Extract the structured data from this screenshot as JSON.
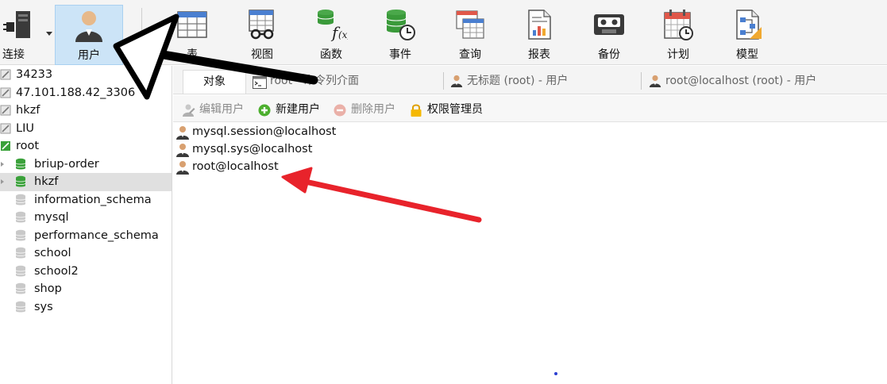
{
  "toolbar": {
    "connect": {
      "label": "连接",
      "icon": "plug-server-icon"
    },
    "user": {
      "label": "用户",
      "icon": "user-icon"
    },
    "table": {
      "label": "表",
      "icon": "table-icon"
    },
    "view": {
      "label": "视图",
      "icon": "view-icon"
    },
    "function": {
      "label": "函数",
      "icon": "function-icon"
    },
    "event": {
      "label": "事件",
      "icon": "event-icon"
    },
    "query": {
      "label": "查询",
      "icon": "query-icon"
    },
    "report": {
      "label": "报表",
      "icon": "report-icon"
    },
    "backup": {
      "label": "备份",
      "icon": "backup-icon"
    },
    "schedule": {
      "label": "计划",
      "icon": "calendar-icon"
    },
    "model": {
      "label": "模型",
      "icon": "model-icon"
    }
  },
  "sidebar": {
    "connections": [
      {
        "label": "34233"
      },
      {
        "label": "47.101.188.42_3306"
      },
      {
        "label": "hkzf"
      },
      {
        "label": "LIU"
      },
      {
        "label": "root"
      }
    ],
    "databases": [
      {
        "label": "briup-order",
        "active": true
      },
      {
        "label": "hkzf",
        "active": true,
        "selected": true
      },
      {
        "label": "information_schema",
        "active": false
      },
      {
        "label": "mysql",
        "active": false
      },
      {
        "label": "performance_schema",
        "active": false
      },
      {
        "label": "school",
        "active": false
      },
      {
        "label": "school2",
        "active": false
      },
      {
        "label": "shop",
        "active": false
      },
      {
        "label": "sys",
        "active": false
      }
    ]
  },
  "tabs": {
    "objects": "对象",
    "console": "root - 命令列介面",
    "untitled": "无标题 (root) - 用户",
    "root_user": "root@localhost (root) - 用户"
  },
  "object_toolbar": {
    "edit_user": "编辑用户",
    "new_user": "新建用户",
    "delete_user": "删除用户",
    "privilege_manager": "权限管理员"
  },
  "users": [
    {
      "label": "mysql.session@localhost"
    },
    {
      "label": "mysql.sys@localhost"
    },
    {
      "label": "root@localhost"
    }
  ],
  "colors": {
    "active_button_bg": "#cce4f7",
    "db_active": "#3aa13a",
    "db_inactive": "#c9c9c9",
    "annotation_black": "#000000",
    "annotation_red": "#e8232b"
  }
}
